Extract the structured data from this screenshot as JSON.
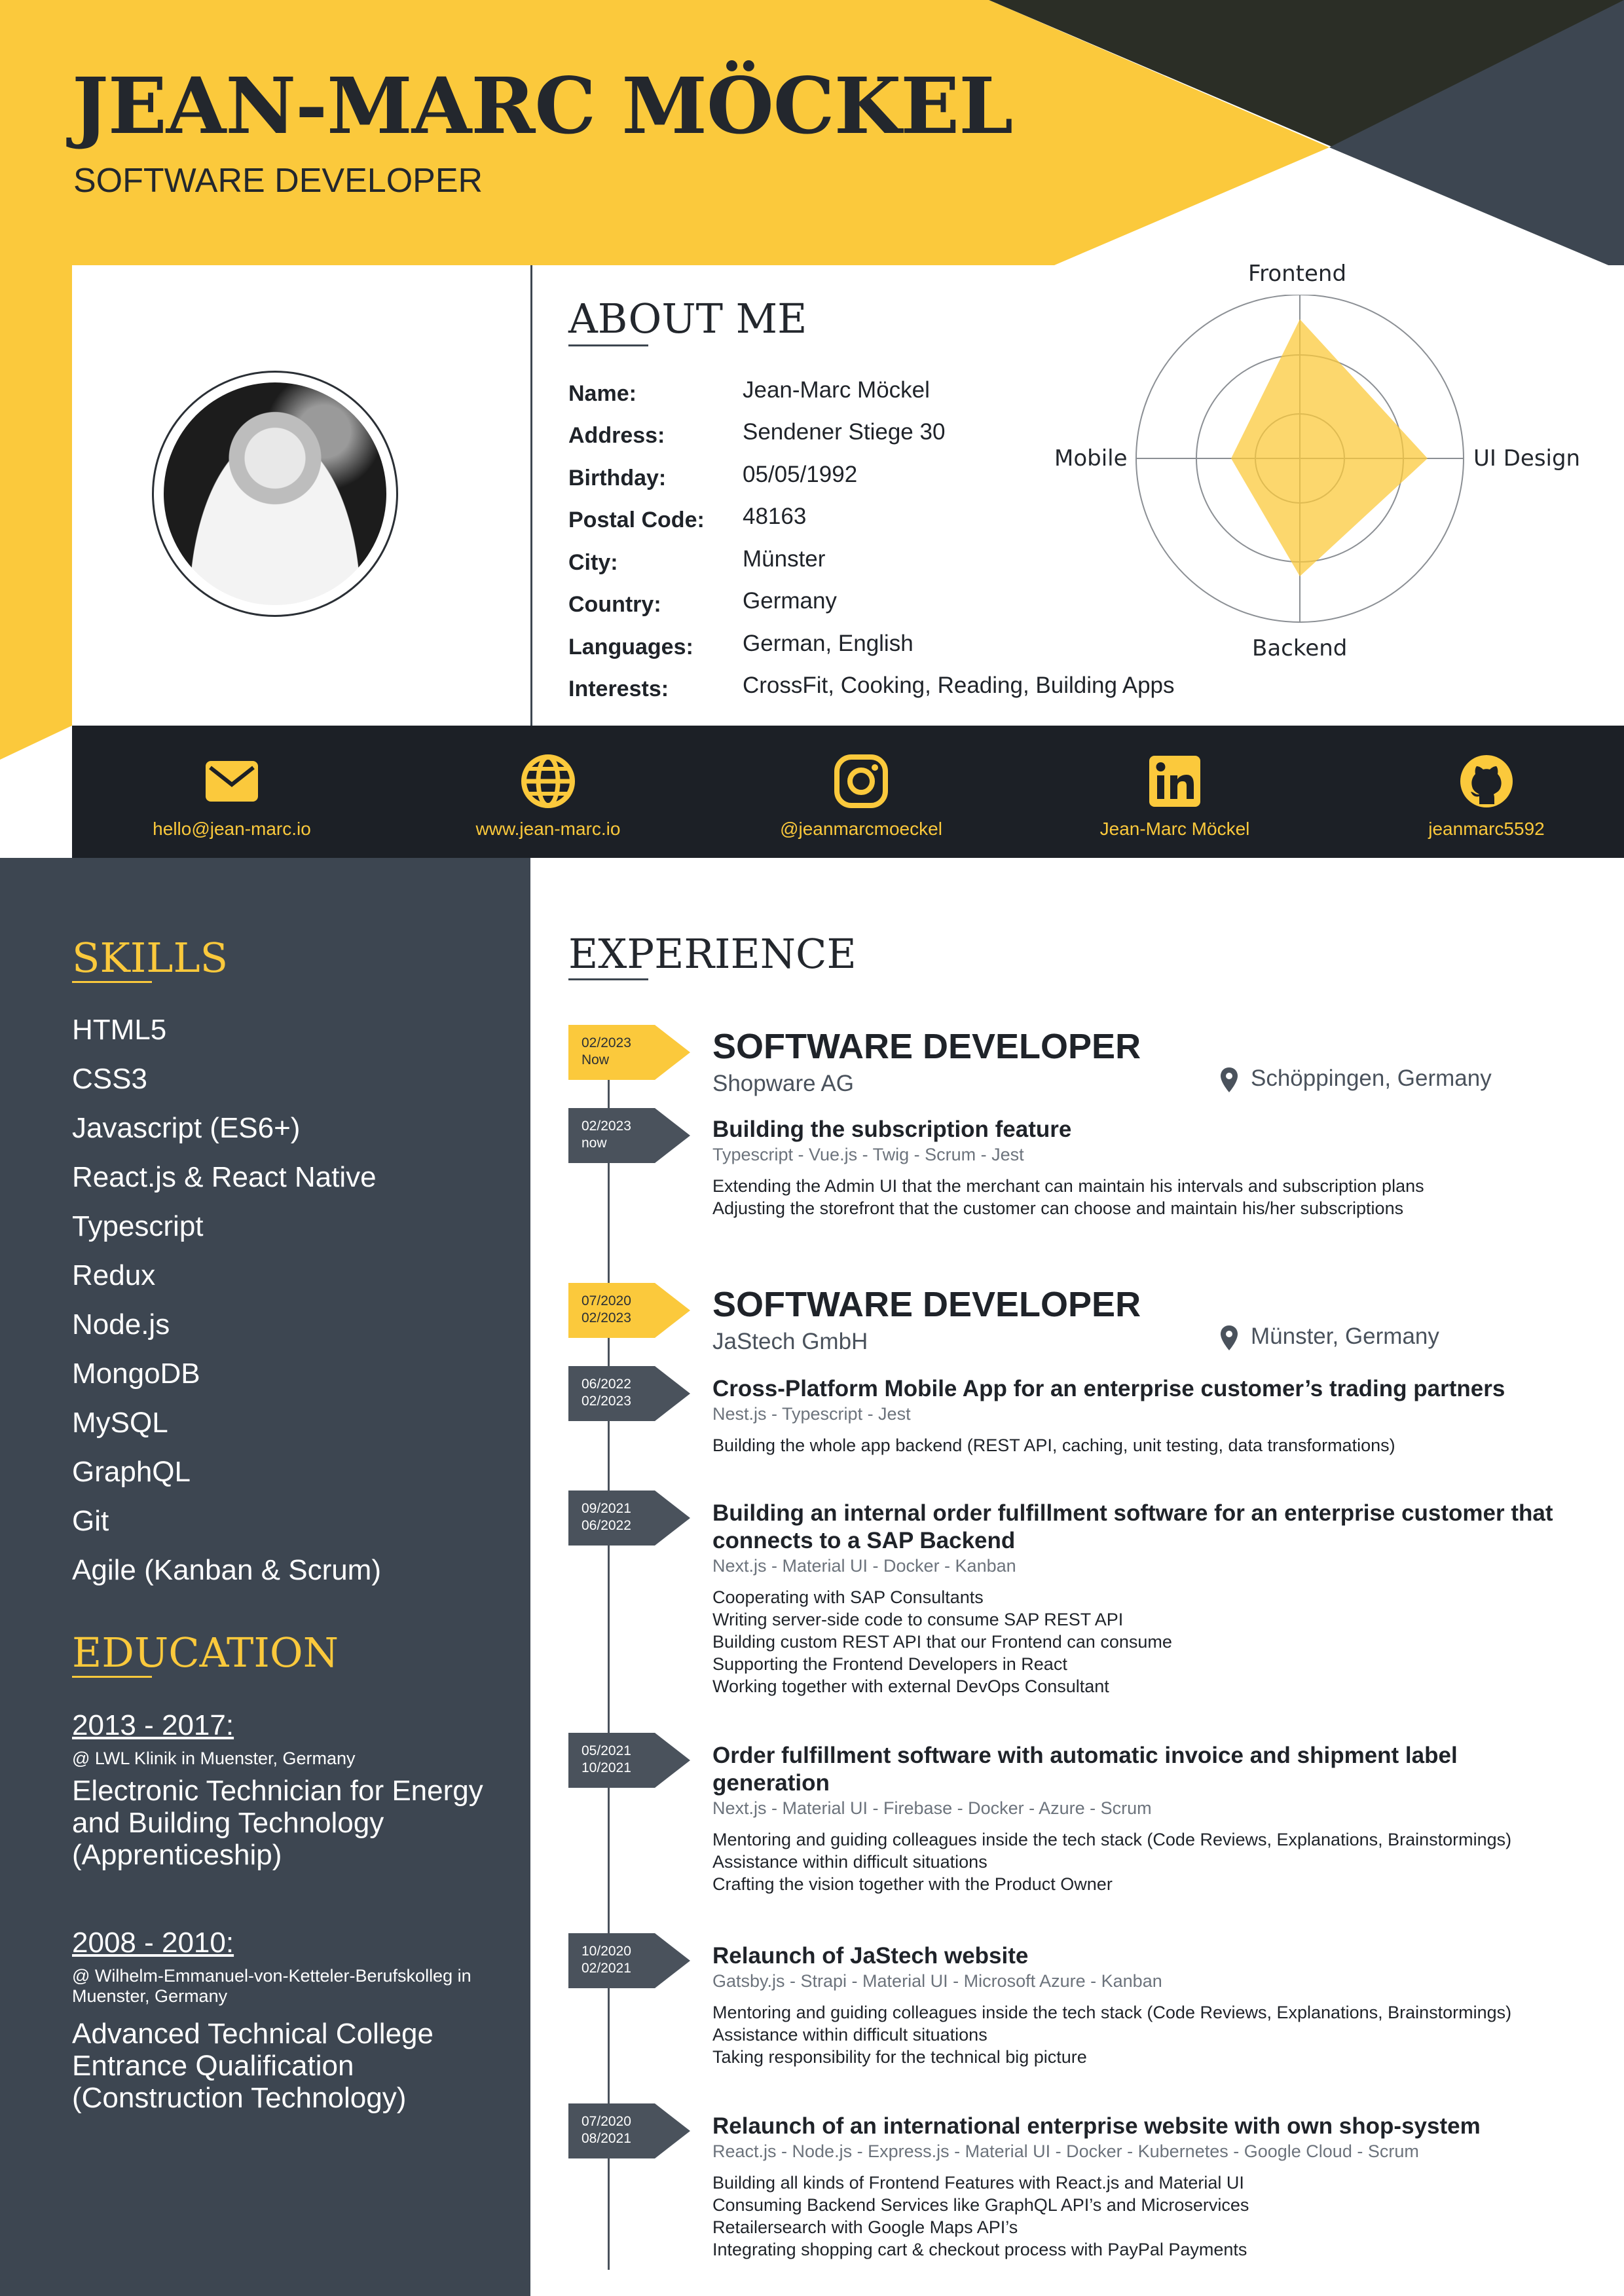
{
  "colors": {
    "accent": "#fbc93c",
    "dark": "#1c2026",
    "sidebar": "#3d4651",
    "text": "#1f2329"
  },
  "header": {
    "name": "JEAN-MARC MÖCKEL",
    "role": "SOFTWARE DEVELOPER"
  },
  "about": {
    "title": "ABOUT ME",
    "rows": [
      {
        "label": "Name:",
        "value": "Jean-Marc Möckel"
      },
      {
        "label": "Address:",
        "value": "Sendener Stiege 30"
      },
      {
        "label": "Birthday:",
        "value": "05/05/1992"
      },
      {
        "label": "Postal Code:",
        "value": "48163"
      },
      {
        "label": "City:",
        "value": "Münster"
      },
      {
        "label": "Country:",
        "value": "Germany"
      },
      {
        "label": "Languages:",
        "value": "German, English"
      },
      {
        "label": "Interests:",
        "value": "CrossFit, Cooking, Reading, Building Apps"
      }
    ],
    "radar": {
      "axes": [
        "Frontend",
        "UI Design",
        "Backend",
        "Mobile"
      ],
      "levels": [
        0.85,
        0.78,
        0.72,
        0.42
      ]
    }
  },
  "contact": [
    {
      "icon": "mail-icon",
      "text": "hello@jean-marc.io"
    },
    {
      "icon": "globe-icon",
      "text": "www.jean-marc.io"
    },
    {
      "icon": "instagram-icon",
      "text": "@jeanmarcmoeckel"
    },
    {
      "icon": "linkedin-icon",
      "text": "Jean-Marc Möckel"
    },
    {
      "icon": "github-icon",
      "text": "jeanmarc5592"
    }
  ],
  "skills": {
    "title": "SKILLS",
    "items": [
      "HTML5",
      "CSS3",
      "Javascript (ES6+)",
      "React.js & React Native",
      "Typescript",
      "Redux",
      "Node.js",
      "MongoDB",
      "MySQL",
      "GraphQL",
      "Git",
      "Agile (Kanban & Scrum)"
    ]
  },
  "education": {
    "title": "EDUCATION",
    "entries": [
      {
        "years": "2013 - 2017:",
        "place": "@ LWL Klinik in Muenster, Germany",
        "degree": "Electronic Technician for Energy and Building Technology (Apprenticeship)"
      },
      {
        "years": "2008 - 2010:",
        "place": "@ Wilhelm-Emmanuel-von-Ketteler-Berufskolleg in Muenster, Germany",
        "degree": "Advanced Technical College Entrance Qualification (Construction Technology)"
      }
    ]
  },
  "experience": {
    "title": "EXPERIENCE",
    "jobs": [
      {
        "d1": "02/2023",
        "d2": "Now",
        "title": "SOFTWARE DEVELOPER",
        "company": "Shopware AG",
        "location": "Schöppingen, Germany"
      },
      {
        "d1": "07/2020",
        "d2": "02/2023",
        "title": "SOFTWARE DEVELOPER",
        "company": "JaStech GmbH",
        "location": "Münster, Germany"
      }
    ],
    "projects": [
      {
        "d1": "02/2023",
        "d2": "now",
        "title": "Building the subscription feature",
        "tech": "Typescript - Vue.js - Twig - Scrum - Jest",
        "desc": [
          "Extending the Admin UI that the merchant can maintain his intervals and subscription plans",
          "Adjusting the storefront that the customer can choose and maintain his/her subscriptions"
        ]
      },
      {
        "d1": "06/2022",
        "d2": "02/2023",
        "title": "Cross-Platform Mobile App for an enterprise customer’s trading partners",
        "tech": "Nest.js - Typescript - Jest",
        "desc": [
          "Building the whole app backend (REST API, caching, unit testing, data transformations)"
        ]
      },
      {
        "d1": "09/2021",
        "d2": "06/2022",
        "title": "Building an internal order fulfillment software for an enterprise customer that connects to a SAP Backend",
        "tech": "Next.js - Material UI - Docker - Kanban",
        "desc": [
          "Cooperating with SAP Consultants",
          "Writing server-side code to consume SAP REST API",
          "Building custom REST API that our Frontend can consume",
          "Supporting the Frontend Developers in React",
          "Working together with external DevOps Consultant"
        ]
      },
      {
        "d1": "05/2021",
        "d2": "10/2021",
        "title": "Order fulfillment software with automatic invoice and shipment label generation",
        "tech": "Next.js - Material UI - Firebase - Docker - Azure - Scrum",
        "desc": [
          "Mentoring and guiding colleagues inside the tech stack (Code Reviews, Explanations, Brainstormings)",
          "Assistance within difficult situations",
          "Crafting the vision together with the Product Owner"
        ]
      },
      {
        "d1": "10/2020",
        "d2": "02/2021",
        "title": "Relaunch of JaStech website",
        "tech": "Gatsby.js - Strapi - Material UI - Microsoft Azure - Kanban",
        "desc": [
          "Mentoring and guiding colleagues inside the tech stack (Code Reviews, Explanations, Brainstormings)",
          "Assistance within difficult situations",
          "Taking responsibility for the technical big picture"
        ]
      },
      {
        "d1": "07/2020",
        "d2": "08/2021",
        "title": "Relaunch of an international enterprise website with own shop-system",
        "tech": "React.js - Node.js - Express.js - Material UI - Docker - Kubernetes - Google Cloud - Scrum",
        "desc": [
          "Building all kinds of Frontend Features with React.js and Material UI",
          "Consuming Backend Services like GraphQL API’s and Microservices",
          "Retailersearch with Google Maps API’s",
          "Integrating shopping cart & checkout process with PayPal Payments"
        ]
      }
    ]
  }
}
